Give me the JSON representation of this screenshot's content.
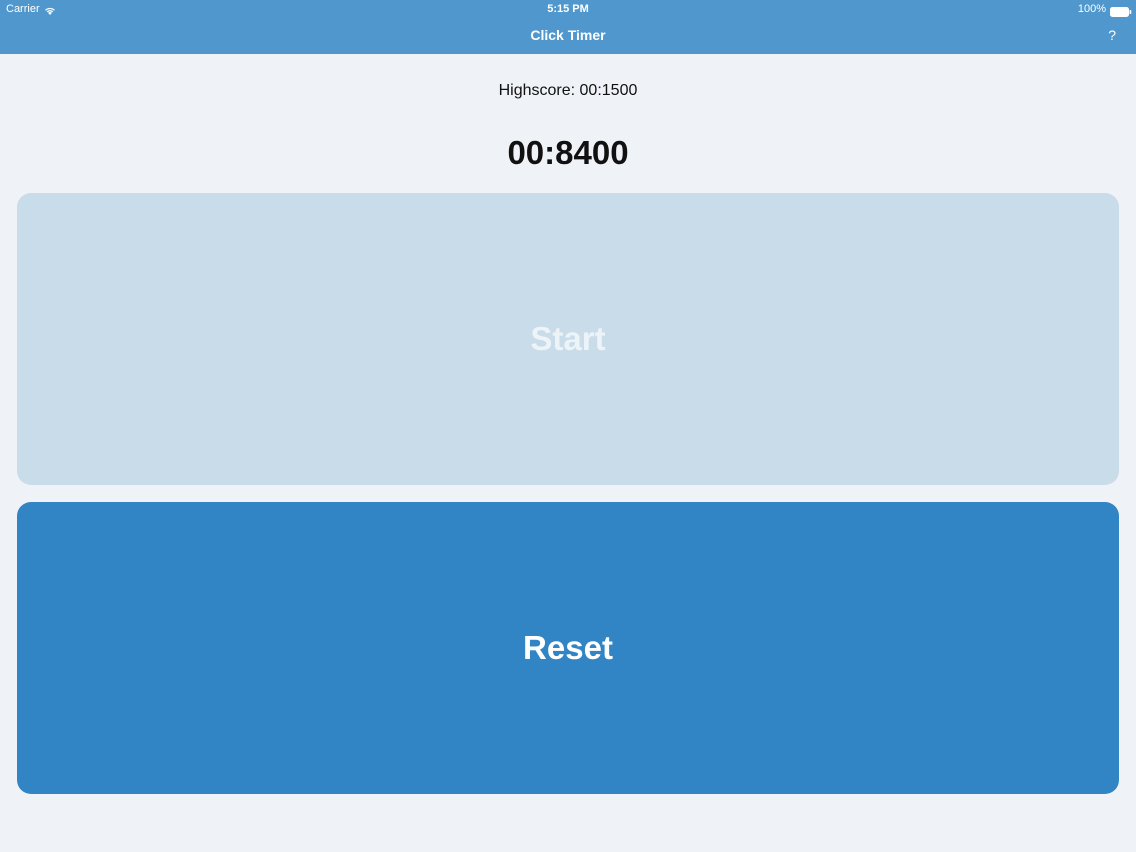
{
  "status_bar": {
    "carrier": "Carrier",
    "time": "5:15 PM",
    "battery": "100%"
  },
  "nav": {
    "title": "Click Timer",
    "help_label": "?"
  },
  "highscore": "Highscore: 00:1500",
  "timer": "00:8400",
  "buttons": {
    "start_label": "Start",
    "reset_label": "Reset"
  },
  "colors": {
    "nav_bar": "#4f97cd",
    "background": "#eff2f7",
    "start_button": "#c9dce9",
    "reset_button": "#3185c4"
  }
}
